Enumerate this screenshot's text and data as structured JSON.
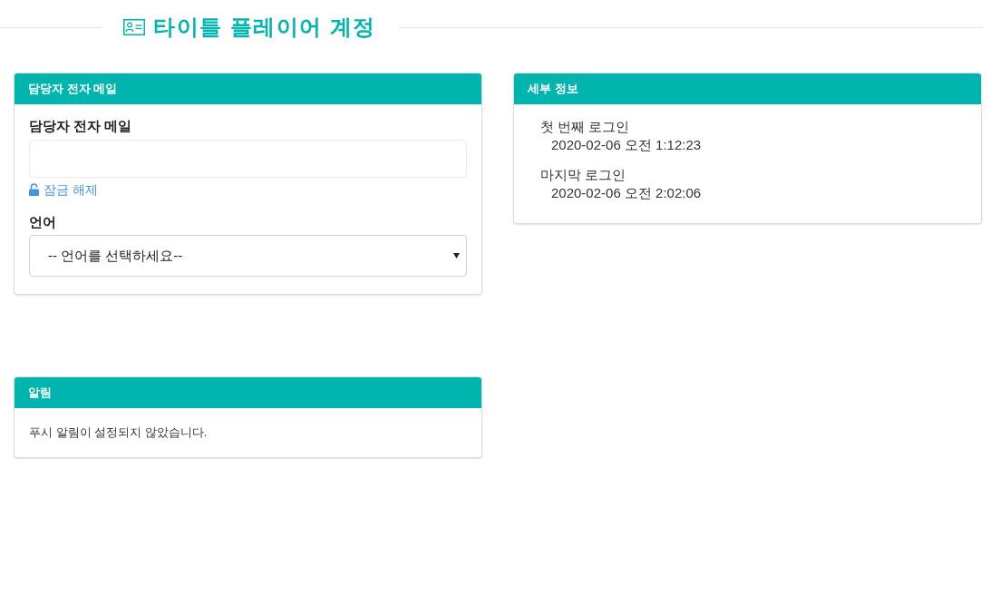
{
  "header": {
    "title": "타이틀 플레이어 계정"
  },
  "contact_card": {
    "title": "담당자 전자 메일",
    "email_field": {
      "label": "담당자 전자 메일"
    },
    "unlock_link": "잠금 해제",
    "language_field": {
      "label": "언어",
      "value": "-- 언어를 선택하세요--"
    }
  },
  "details_card": {
    "title": "세부 정보",
    "items": [
      {
        "label": "첫 번째 로그인",
        "value": "2020-02-06 오전 1:12:23"
      },
      {
        "label": "마지막 로그인",
        "value": "2020-02-06 오전 2:02:06"
      }
    ]
  },
  "notifications_card": {
    "title": "알림",
    "message": "푸시 알림이 설정되지 않았습니다."
  }
}
